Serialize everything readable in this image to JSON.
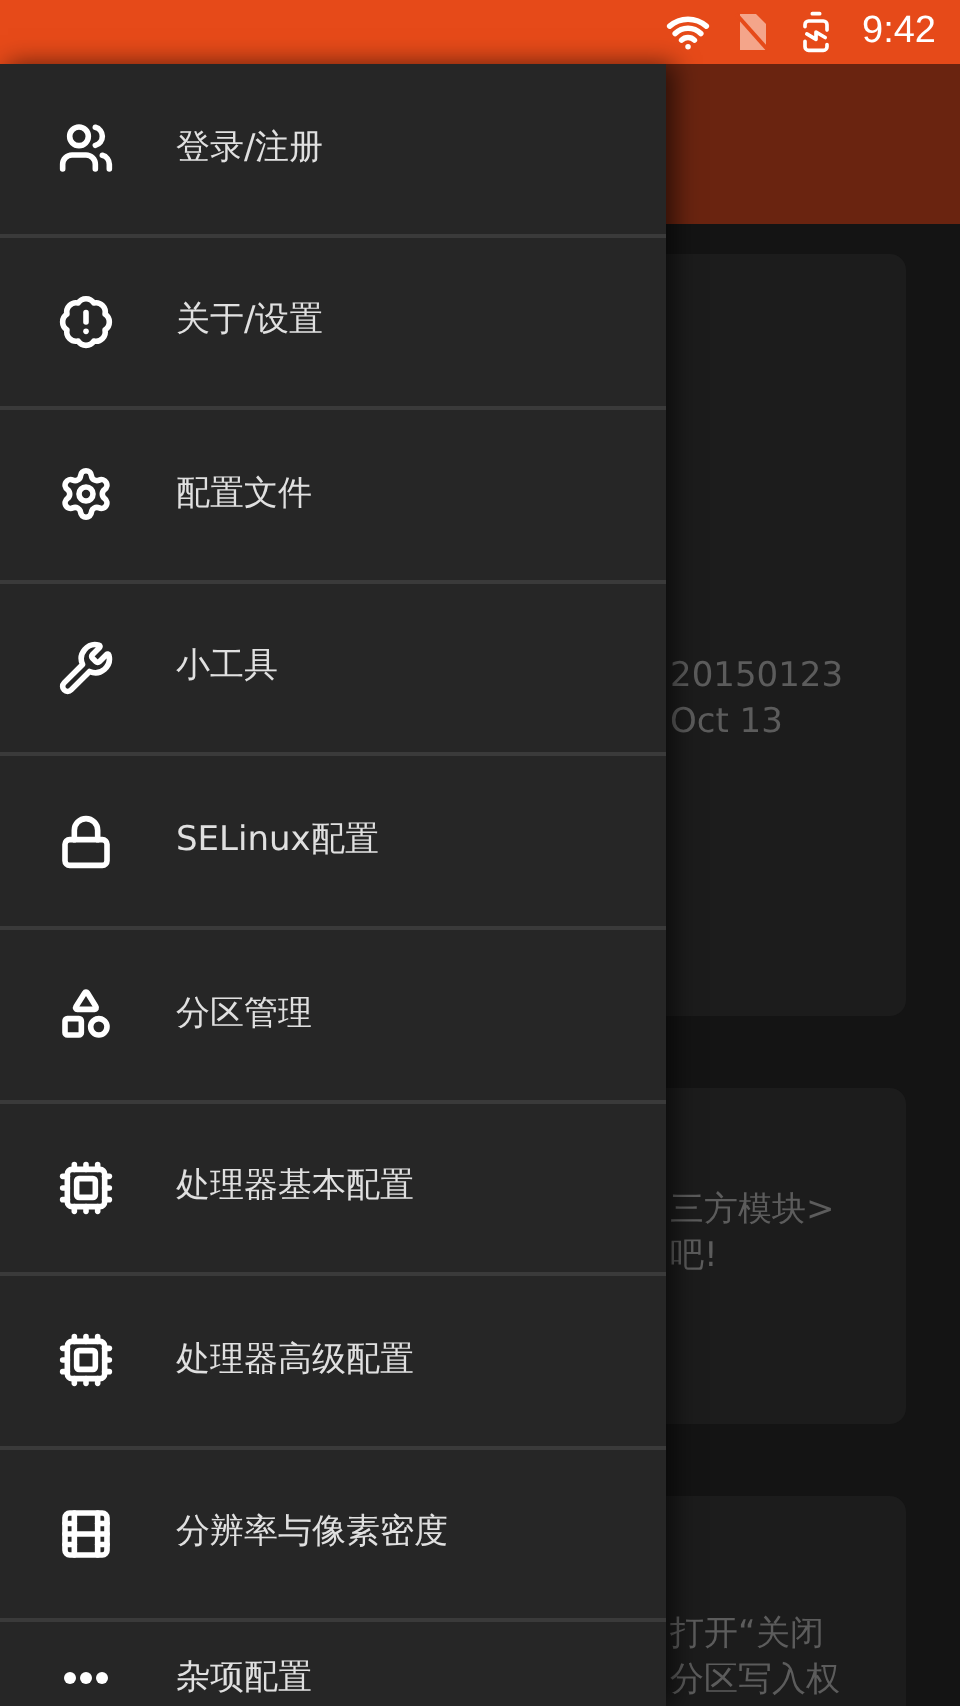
{
  "status_bar": {
    "time": "9:42"
  },
  "drawer": {
    "items": [
      {
        "label": "登录/注册"
      },
      {
        "label": "关于/设置"
      },
      {
        "label": "配置文件"
      },
      {
        "label": "小工具"
      },
      {
        "label": "SELinux配置"
      },
      {
        "label": "分区管理"
      },
      {
        "label": "处理器基本配置"
      },
      {
        "label": "处理器高级配置"
      },
      {
        "label": "分辨率与像素密度"
      },
      {
        "label": "杂项配置"
      }
    ]
  },
  "cards": [
    {
      "lines": [
        "20150123",
        "Oct 13"
      ]
    },
    {
      "lines": [
        "三方模块>",
        "吧!"
      ]
    },
    {
      "lines": [
        "打开“关闭",
        "分区写入权"
      ]
    }
  ]
}
